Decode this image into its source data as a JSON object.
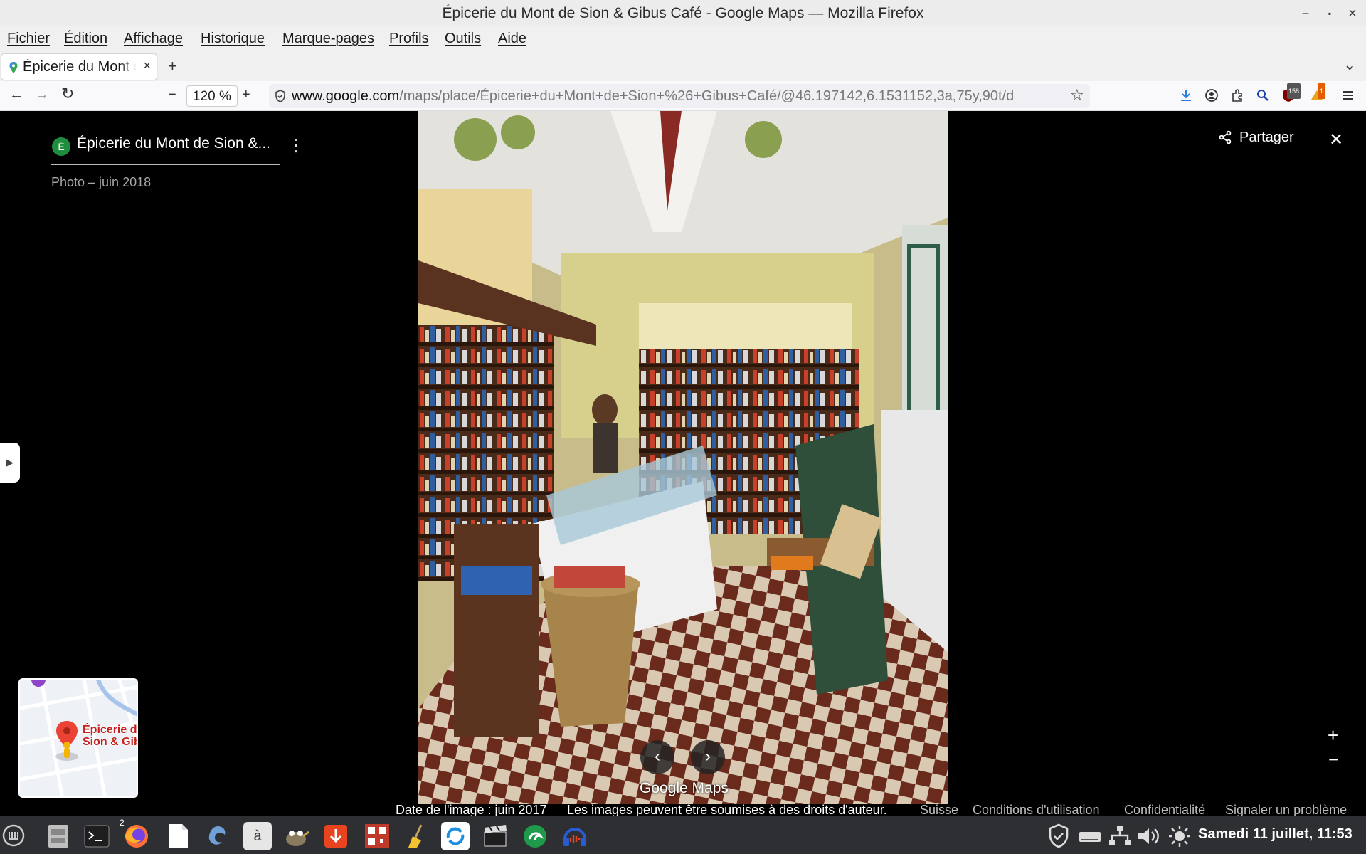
{
  "window": {
    "title": "Épicerie du Mont de Sion & Gibus Café - Google Maps — Mozilla Firefox",
    "minimize_glyph": "–",
    "maximize_glyph": "▪",
    "close_glyph": "×"
  },
  "menu": [
    "Fichier",
    "Édition",
    "Affichage",
    "Historique",
    "Marque-pages",
    "Profils",
    "Outils",
    "Aide"
  ],
  "tab": {
    "title": "Épicerie du Mont de Sion & Gibus Café",
    "close_glyph": "×",
    "new_tab_glyph": "+",
    "list_glyph": "⌄"
  },
  "nav": {
    "back_glyph": "←",
    "forward_glyph": "→",
    "reload_glyph": "↻",
    "zoom_out_glyph": "−",
    "zoom_level": "120 %",
    "zoom_in_glyph": "+",
    "url_host": "www.google.com",
    "url_path": "/maps/place/Épicerie+du+Mont+de+Sion+%26+Gibus+Café/@46.197142,6.1531152,3a,75y,90t/d",
    "bookmark_glyph": "☆",
    "badge_count_1": "158",
    "badge_count_2": "1"
  },
  "panel": {
    "avatar_letter": "É",
    "place_title": "Épicerie du Mont de Sion &...",
    "photo_date": "Photo – juin 2018",
    "more_glyph": "⋮",
    "expand_glyph": "▶"
  },
  "viewer": {
    "share_label": "Partager",
    "close_glyph": "✕",
    "prev_glyph": "‹",
    "next_glyph": "›",
    "watermark": "Google Maps",
    "zoom_in_glyph": "+",
    "zoom_out_glyph": "−"
  },
  "minimap": {
    "label_line1": "Épicerie du",
    "label_line2": "Sion & Gibus"
  },
  "footer": {
    "image_date": "Date de l'image : juin 2017",
    "copyright": "Les images peuvent être soumises à des droits d'auteur.",
    "country": "Suisse",
    "terms": "Conditions d'utilisation",
    "privacy": "Confidentialité",
    "report": "Signaler un problème"
  },
  "taskbar": {
    "terminal_badge": "2",
    "keyboard_glyph": "à",
    "clock": "Samedi 11 juillet, 11:53"
  },
  "colors": {
    "menu_bg": "#f0f0f0",
    "viewer_bg": "#000000",
    "avatar_green": "#1e8e3e",
    "map_pin_red": "#ea4335",
    "taskbar_bg": "#2d2f33"
  }
}
